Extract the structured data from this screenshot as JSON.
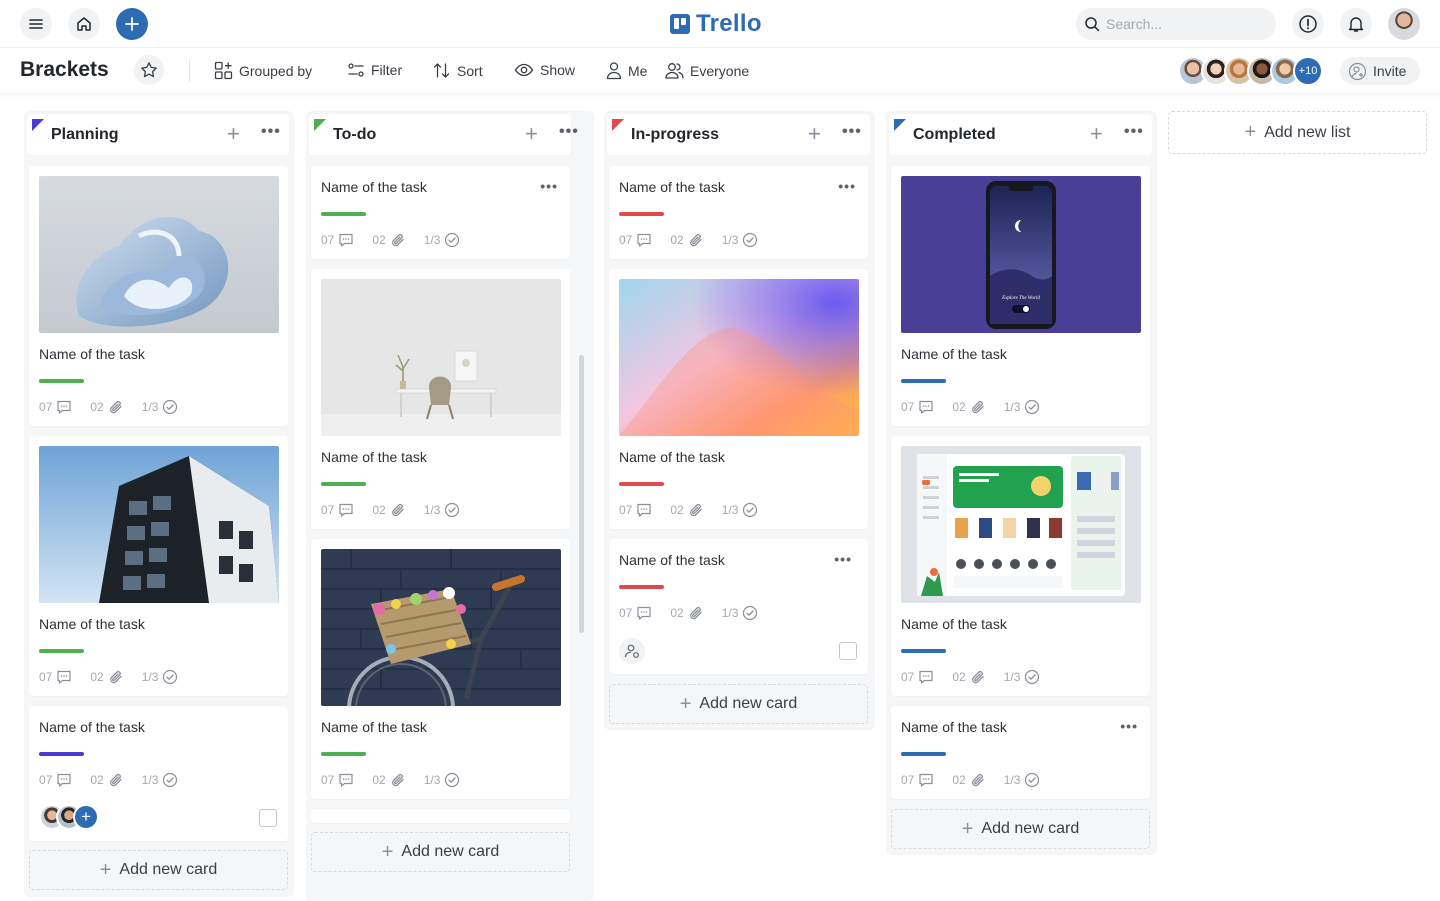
{
  "header": {
    "logo": "Trello",
    "search_placeholder": "Search...",
    "icons": [
      "menu-icon",
      "home-icon",
      "plus-icon",
      "alert-icon",
      "bell-icon"
    ]
  },
  "toolbar": {
    "board_title": "Brackets",
    "grouped_by": "Grouped by",
    "filter": "Filter",
    "sort": "Sort",
    "show": "Show",
    "me": "Me",
    "everyone": "Everyone",
    "members_more": "+10",
    "invite": "Invite"
  },
  "colors": {
    "brand": "#2d6bb3",
    "green": "#4caf50",
    "red": "#e04a4e",
    "purple": "#4b3bd6",
    "blue": "#2d6bb3"
  },
  "card_meta": {
    "comments": "07",
    "attachments": "02",
    "checklist": "1/3"
  },
  "lists": [
    {
      "title": "Planning",
      "flag_color": "#4b3bd6",
      "cards": [
        {
          "title": "Name of the task",
          "image": "abstract-blue-shape",
          "bar_color": "#4caf50"
        },
        {
          "title": "Name of the task",
          "image": "building-sky",
          "bar_color": "#4caf50"
        },
        {
          "title": "Name of the task",
          "image": null,
          "bar_color": "#4b3bd6",
          "members": 2
        }
      ],
      "add_card": "Add new card"
    },
    {
      "title": "To-do",
      "flag_color": "#4caf50",
      "cards": [
        {
          "title": "Name of the task",
          "image": null,
          "bar_color": "#4caf50"
        },
        {
          "title": "Name of the task",
          "image": "desk-chair-room",
          "bar_color": "#4caf50"
        },
        {
          "title": "Name of the task",
          "image": "bicycle-flowers",
          "bar_color": "#4caf50"
        }
      ],
      "add_card": "Add new card"
    },
    {
      "title": "In-progress",
      "flag_color": "#e04a4e",
      "cards": [
        {
          "title": "Name of the task",
          "image": null,
          "bar_color": "#e04a4e"
        },
        {
          "title": "Name of the task",
          "image": "color-gradient",
          "bar_color": "#e04a4e"
        },
        {
          "title": "Name of the task",
          "image": null,
          "bar_color": "#e04a4e"
        }
      ],
      "add_card": "Add new card"
    },
    {
      "title": "Completed",
      "flag_color": "#2d6bb3",
      "cards": [
        {
          "title": "Name of the task",
          "image": "phone-mockup",
          "bar_color": "#2d6bb3",
          "image_caption": "Explore The World"
        },
        {
          "title": "Name of the task",
          "image": "book-app-dashboard",
          "bar_color": "#2d6bb3"
        },
        {
          "title": "Name of the task",
          "image": null,
          "bar_color": "#2d6bb3"
        }
      ],
      "add_card": "Add new card"
    }
  ],
  "add_list": "Add new list"
}
